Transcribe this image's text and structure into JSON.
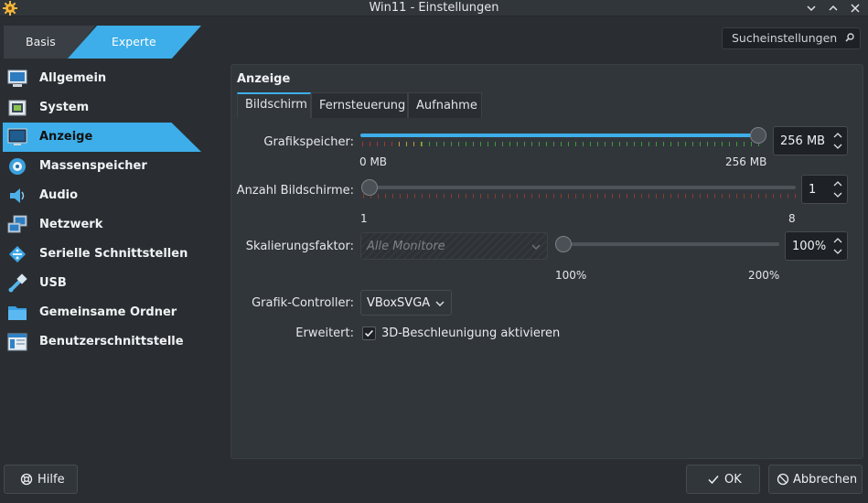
{
  "window": {
    "title": "Win11 - Einstellungen"
  },
  "modes": {
    "basic": "Basis",
    "expert": "Experte"
  },
  "search": {
    "label": "Sucheinstellungen"
  },
  "sidebar": {
    "items": [
      {
        "label": "Allgemein",
        "icon": "monitor-general-icon"
      },
      {
        "label": "System",
        "icon": "chip-icon"
      },
      {
        "label": "Anzeige",
        "icon": "display-icon"
      },
      {
        "label": "Massenspeicher",
        "icon": "disk-icon"
      },
      {
        "label": "Audio",
        "icon": "speaker-icon"
      },
      {
        "label": "Netzwerk",
        "icon": "network-icon"
      },
      {
        "label": "Serielle Schnittstellen",
        "icon": "serial-port-icon"
      },
      {
        "label": "USB",
        "icon": "usb-icon"
      },
      {
        "label": "Gemeinsame Ordner",
        "icon": "folder-icon"
      },
      {
        "label": "Benutzerschnittstelle",
        "icon": "ui-window-icon"
      }
    ],
    "active_index": 2
  },
  "panel": {
    "title": "Anzeige",
    "tabs": [
      "Bildschirm",
      "Fernsteuerung",
      "Aufnahme"
    ],
    "active_tab": 0,
    "video_memory": {
      "label": "Grafikspeicher:",
      "value": "256 MB",
      "min_label": "0 MB",
      "max_label": "256 MB",
      "fraction": 1.0
    },
    "monitors": {
      "label": "Anzahl Bildschirme:",
      "value": "1",
      "min_label": "1",
      "max_label": "8",
      "fraction": 0.0
    },
    "scaling": {
      "label": "Skalierungsfaktor:",
      "combo_value": "Alle Monitore",
      "value": "100%",
      "min_label": "100%",
      "max_label": "200%",
      "fraction": 0.0
    },
    "controller": {
      "label": "Grafik-Controller:",
      "value": "VBoxSVGA"
    },
    "extended": {
      "label": "Erweitert:",
      "checkbox_label": "3D-Beschleunigung aktivieren",
      "checked": true
    }
  },
  "buttons": {
    "help": "Hilfe",
    "ok": "OK",
    "cancel": "Abbrechen"
  },
  "colors": {
    "accent": "#3daee9",
    "background": "#2a2e32",
    "panel": "#31363b"
  }
}
